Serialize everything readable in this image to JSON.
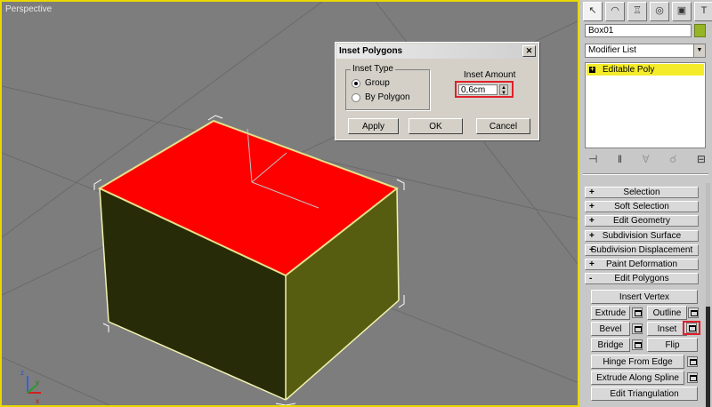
{
  "viewport": {
    "label": "Perspective",
    "axis_labels": {
      "z": "z",
      "x": "x",
      "y": "y"
    }
  },
  "dialog": {
    "title": "Inset Polygons",
    "close_glyph": "✕",
    "inset_type_label": "Inset Type",
    "options": [
      "Group",
      "By Polygon"
    ],
    "selected_option": "Group",
    "inset_amount_label": "Inset Amount",
    "inset_amount_value": "0,6cm",
    "buttons": {
      "apply": "Apply",
      "ok": "OK",
      "cancel": "Cancel"
    }
  },
  "panel": {
    "tabs": [
      "select-arrow-icon",
      "curve-icon",
      "hierarchy-icon",
      "motion-icon",
      "display-icon",
      "utilities-hammer-icon"
    ],
    "object_name": "Box01",
    "object_color": "#95b526",
    "modifier_list": "Modifier List",
    "stack_item": "Editable Poly",
    "rollouts": [
      {
        "label": "Selection",
        "sign": "+"
      },
      {
        "label": "Soft Selection",
        "sign": "+"
      },
      {
        "label": "Edit Geometry",
        "sign": "+"
      },
      {
        "label": "Subdivision Surface",
        "sign": "+"
      },
      {
        "label": "Subdivision Displacement",
        "sign": "+"
      },
      {
        "label": "Paint Deformation",
        "sign": "+"
      },
      {
        "label": "Edit Polygons",
        "sign": "-"
      }
    ],
    "edit_polygons": {
      "insert_vertex": "Insert Vertex",
      "extrude": "Extrude",
      "outline": "Outline",
      "bevel": "Bevel",
      "inset": "Inset",
      "bridge": "Bridge",
      "flip": "Flip",
      "hinge_from_edge": "Hinge From Edge",
      "extrude_along_spline": "Extrude Along Spline",
      "edit_triangulation": "Edit Triangulation"
    }
  },
  "colors": {
    "selection_face": "#ff0000",
    "box_side_left": "#2a2f07",
    "box_side_right": "#5a620f",
    "highlight": "#e0202a"
  }
}
